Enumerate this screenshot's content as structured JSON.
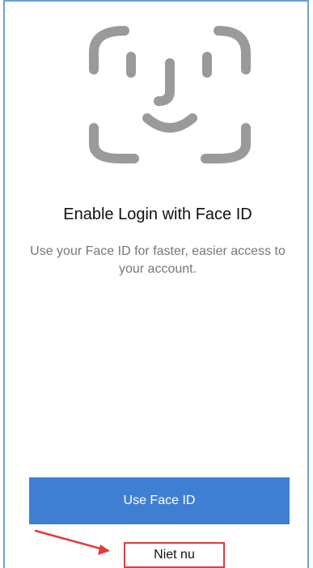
{
  "screen": {
    "title": "Enable Login with Face ID",
    "subtitle": "Use your Face ID for faster, easier access to your account."
  },
  "actions": {
    "primary_label": "Use Face ID",
    "secondary_label": "Niet nu"
  },
  "icons": {
    "hero": "face-id-icon",
    "annotation": "annotation-arrow-icon"
  },
  "colors": {
    "primary": "#3f7fd3",
    "icon_gray": "#9a9a9a",
    "title_text": "#111111",
    "subtitle_text": "#777777",
    "annotation_red": "#e53a3a",
    "frame_blue": "#6d9fd6"
  }
}
